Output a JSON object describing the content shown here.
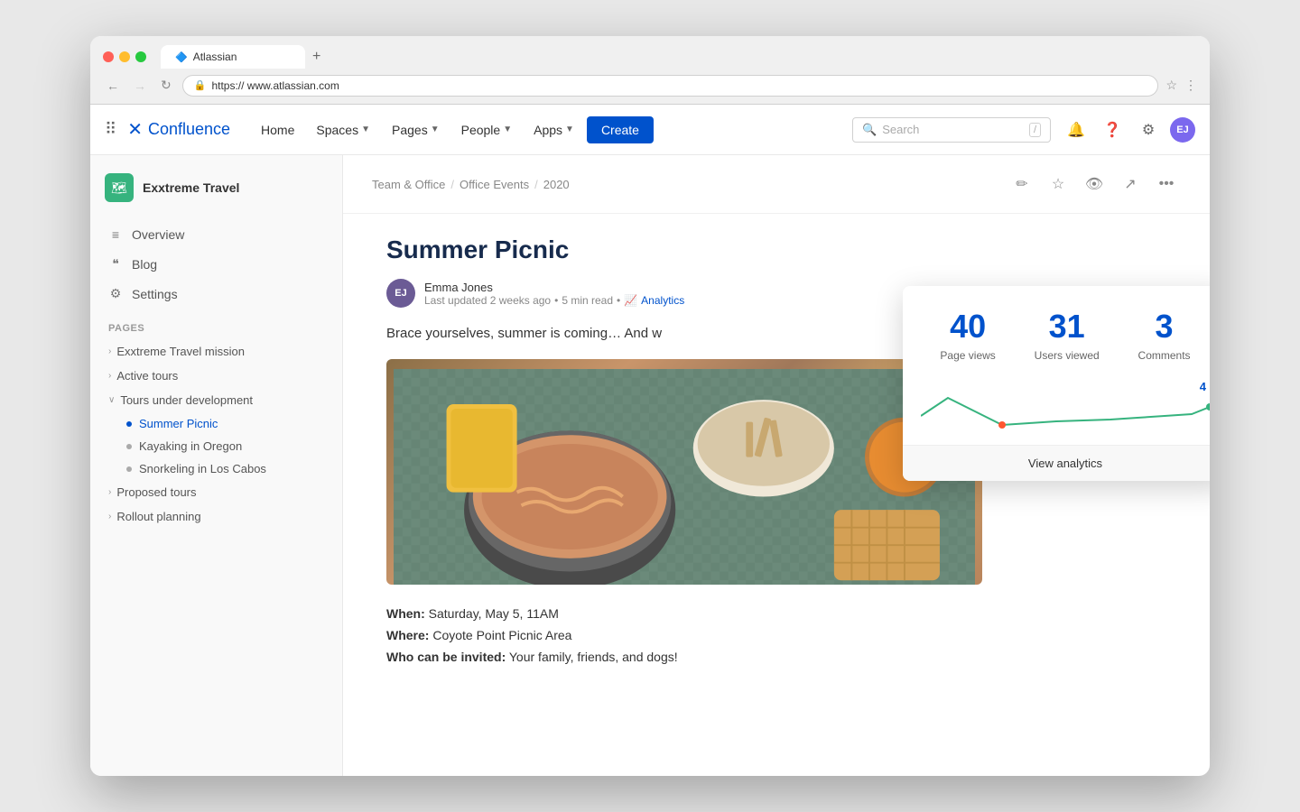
{
  "browser": {
    "tab_title": "Atlassian",
    "url": "https:// www.atlassian.com",
    "new_tab_icon": "+",
    "back_icon": "←",
    "forward_icon": "→",
    "refresh_icon": "↻"
  },
  "nav": {
    "logo_text": "Confluence",
    "home_label": "Home",
    "spaces_label": "Spaces",
    "pages_label": "Pages",
    "people_label": "People",
    "apps_label": "Apps",
    "create_label": "Create",
    "search_placeholder": "Search",
    "search_shortcut": "/"
  },
  "sidebar": {
    "space_name": "Exxtreme Travel",
    "overview_label": "Overview",
    "blog_label": "Blog",
    "settings_label": "Settings",
    "pages_section": "Pages",
    "pages": [
      {
        "label": "Exxtreme Travel mission",
        "expanded": false
      },
      {
        "label": "Active tours",
        "expanded": false
      },
      {
        "label": "Tours under development",
        "expanded": true,
        "children": [
          {
            "label": "Summer Picnic",
            "active": true
          },
          {
            "label": "Kayaking in Oregon",
            "active": false
          },
          {
            "label": "Snorkeling in Los Cabos",
            "active": false
          }
        ]
      },
      {
        "label": "Proposed tours",
        "expanded": false
      },
      {
        "label": "Rollout planning",
        "expanded": false
      }
    ]
  },
  "breadcrumb": {
    "items": [
      "Team & Office",
      "Office Events",
      "2020"
    ]
  },
  "page": {
    "title": "Summer Picnic",
    "author_name": "Emma Jones",
    "author_initials": "EJ",
    "last_updated": "Last updated 2 weeks ago",
    "read_time": "5 min read",
    "analytics_label": "Analytics",
    "intro_text": "Brace yourselves, summer is coming… And w",
    "when_label": "When:",
    "when_value": "Saturday, May 5, 11AM",
    "where_label": "Where:",
    "where_value": "Coyote Point Picnic Area",
    "who_label": "Who can be invited:",
    "who_value": "Your family, friends, and dogs!"
  },
  "analytics": {
    "page_views_number": "40",
    "page_views_label": "Page views",
    "users_viewed_number": "31",
    "users_viewed_label": "Users viewed",
    "comments_number": "3",
    "comments_label": "Comments",
    "chart_value": "4",
    "view_analytics_label": "View analytics"
  }
}
